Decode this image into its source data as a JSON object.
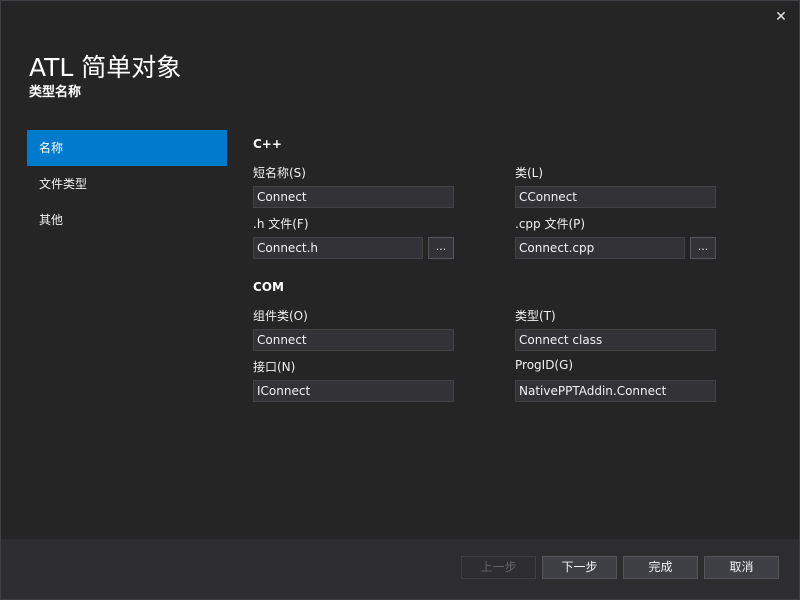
{
  "window": {
    "close_glyph": "✕",
    "title": "ATL 简单对象",
    "subtitle": "类型名称"
  },
  "nav": {
    "items": [
      {
        "label": "名称",
        "active": true
      },
      {
        "label": "文件类型",
        "active": false
      },
      {
        "label": "其他",
        "active": false
      }
    ]
  },
  "cpp": {
    "section_label": "C++",
    "short_name_label": "短名称(S)",
    "short_name_value": "Connect",
    "class_label": "类(L)",
    "class_value": "CConnect",
    "h_file_label": ".h 文件(F)",
    "h_file_value": "Connect.h",
    "cpp_file_label": ".cpp 文件(P)",
    "cpp_file_value": "Connect.cpp",
    "browse_label": "..."
  },
  "com": {
    "section_label": "COM",
    "coclass_label": "组件类(O)",
    "coclass_value": "Connect",
    "type_label": "类型(T)",
    "type_value": "Connect class",
    "interface_label": "接口(N)",
    "interface_value": "IConnect",
    "progid_label": "ProgID(G)",
    "progid_value": "NativePPTAddin.Connect"
  },
  "footer": {
    "prev_label": "上一步",
    "next_label": "下一步",
    "finish_label": "完成",
    "cancel_label": "取消"
  },
  "colors": {
    "background": "#252526",
    "accent": "#007acc",
    "input_bg": "#333337",
    "footer_bg": "#2d2d30"
  }
}
